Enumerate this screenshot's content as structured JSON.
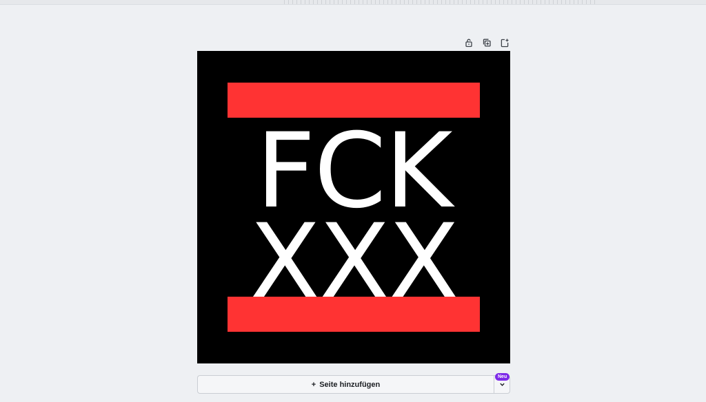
{
  "page_toolbar": {
    "lock_icon": "lock-icon",
    "duplicate_icon": "duplicate-page-icon",
    "add_icon": "add-page-icon"
  },
  "design": {
    "line1": "FCK",
    "line2": "XXX",
    "background_color": "#000000",
    "bar_color": "#ff3333",
    "text_color": "#ffffff"
  },
  "add_page": {
    "plus": "+",
    "label": "Seite hinzufügen",
    "badge": "Neu",
    "badge_color": "#7d2ae8",
    "dropdown_icon": "chevron-down-icon"
  }
}
